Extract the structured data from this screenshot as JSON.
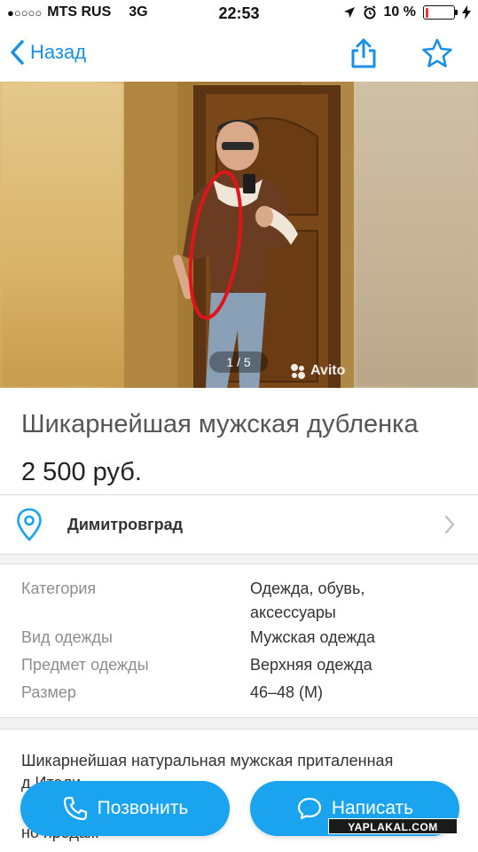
{
  "status_bar": {
    "signal": "●○○○○",
    "carrier": "MTS RUS",
    "network": "3G",
    "time": "22:53",
    "battery": "10 %",
    "battery_level": 0.1
  },
  "nav": {
    "back_label": "Назад"
  },
  "photo": {
    "counter": "1 / 5",
    "brand": "Avito"
  },
  "listing": {
    "title": "Шикарнейшая мужская дубленка",
    "price": "2 500 руб.",
    "location": "Димитровград"
  },
  "params": [
    {
      "label": "Категория",
      "value": "Одежда, обувь, аксессуары"
    },
    {
      "label": "Вид одежды",
      "value": "Мужская одежда"
    },
    {
      "label": "Предмет одежды",
      "value": "Верхняя одежда"
    },
    {
      "label": "Размер",
      "value": "46–48 (M)"
    }
  ],
  "description": {
    "line1": "Шикарнейшая натуральная мужская приталенная",
    "line2": "д                                  Итали",
    "line3": "но                  продаж                  "
  },
  "actions": {
    "call_label": "Позвонить",
    "write_label": "Написать"
  },
  "watermark": "YAPLAKAL.COM",
  "colors": {
    "accent": "#1aa4f0",
    "link": "#1a8fe3",
    "battery_low": "#e23b3b"
  }
}
